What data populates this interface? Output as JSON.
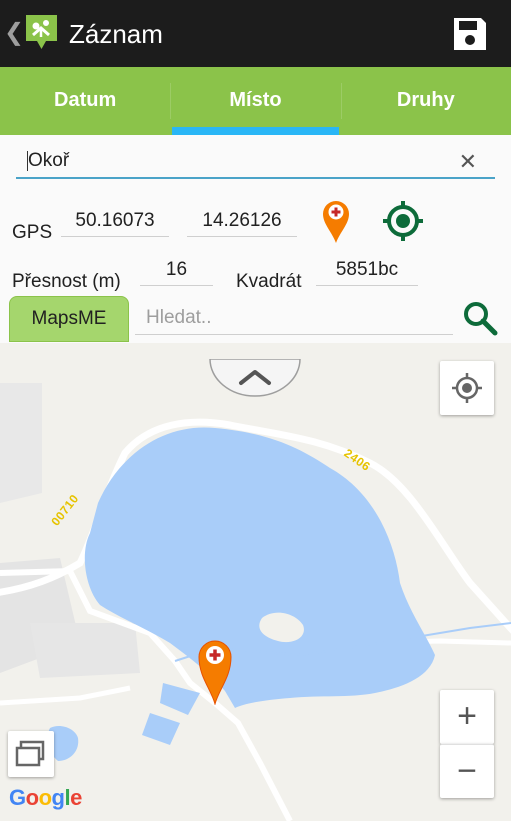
{
  "appbar": {
    "back_icon": "chevron-left-icon",
    "logo_icon": "app-logo-icon",
    "title": "Záznam",
    "save_icon": "save-icon"
  },
  "tabs": [
    {
      "label": "Datum",
      "active": false
    },
    {
      "label": "Místo",
      "active": true
    },
    {
      "label": "Druhy",
      "active": false
    }
  ],
  "form": {
    "place_value": "Okoř",
    "clear_icon": "close-icon",
    "gps_label": "GPS",
    "latitude": "50.16073",
    "longitude": "14.26126",
    "add_pin_icon": "map-pin-add-icon",
    "locate_icon": "gps-target-icon",
    "accuracy_label": "Přesnost (m)",
    "accuracy_value": "16",
    "square_label": "Kvadrát",
    "square_value": "5851bc",
    "mapsme_button": "MapsME",
    "search_placeholder": "Hledat..",
    "search_icon": "search-icon"
  },
  "map": {
    "collapse_icon": "chevron-up-icon",
    "my_location_icon": "my-location-icon",
    "road_labels": [
      "00710",
      "2406"
    ],
    "zoom_in": "+",
    "zoom_out": "−",
    "layers_icon": "layers-icon",
    "attribution": "Google",
    "colors": {
      "water": "#a9cdf9",
      "land": "#f2f1ec",
      "road": "#ffffff",
      "accent_green": "#8bc34a",
      "tab_indicator": "#29b6f6",
      "marker_orange": "#f57c00"
    }
  }
}
